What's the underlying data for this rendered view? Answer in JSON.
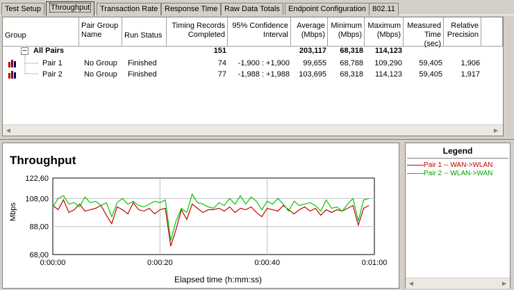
{
  "tabs": [
    "Test Setup",
    "Throughput",
    "Transaction Rate",
    "Response Time",
    "Raw Data Totals",
    "Endpoint Configuration",
    "802.11"
  ],
  "active_tab": 1,
  "table": {
    "headers": {
      "group": "Group",
      "pair_group_name": "Pair Group Name",
      "run_status": "Run Status",
      "timing_records": "Timing Records Completed",
      "confidence": "95% Confidence Interval",
      "average": "Average (Mbps)",
      "minimum": "Minimum (Mbps)",
      "maximum": "Maximum (Mbps)",
      "measured_time": "Measured Time (sec)",
      "relative_precision": "Relative Precision"
    },
    "all_pairs": {
      "expander": "−",
      "label": "All Pairs",
      "timing_records": "151",
      "average": "203,117",
      "minimum": "68,318",
      "maximum": "114,123"
    },
    "rows": [
      {
        "group": "Pair 1",
        "pair_group_name": "No Group",
        "run_status": "Finished",
        "timing_records": "74",
        "confidence": "-1,900 : +1,900",
        "average": "99,655",
        "minimum": "68,788",
        "maximum": "109,290",
        "measured_time": "59,405",
        "relative_precision": "1,906"
      },
      {
        "group": "Pair 2",
        "pair_group_name": "No Group",
        "run_status": "Finished",
        "timing_records": "77",
        "confidence": "-1,988 : +1,988",
        "average": "103,695",
        "minimum": "68,318",
        "maximum": "114,123",
        "measured_time": "59,405",
        "relative_precision": "1,917"
      }
    ]
  },
  "chart": {
    "title": "Throughput",
    "ylabel": "Mbps",
    "xlabel": "Elapsed time (h:mm:ss)",
    "yticks": [
      "122,60",
      "108,00",
      "88,00",
      "68,00"
    ],
    "xticks": [
      "0:00:00",
      "0:00:20",
      "0:00:40",
      "0:01:00"
    ],
    "colors": {
      "pair1": "#c00000",
      "pair2": "#00c800"
    }
  },
  "legend": {
    "title": "Legend",
    "items": [
      "Pair 1 -- WAN->WLAN",
      "Pair 2 -- WLAN->WAN"
    ]
  },
  "chart_data": {
    "type": "line",
    "title": "Throughput",
    "xlabel": "Elapsed time (h:mm:ss)",
    "ylabel": "Mbps",
    "xlim": [
      0,
      60
    ],
    "ylim": [
      68,
      122.6
    ],
    "series": [
      {
        "name": "Pair 1 -- WAN->WLAN",
        "color": "#c00000",
        "x": [
          0,
          1,
          2,
          3,
          4,
          5,
          6,
          7,
          8,
          9,
          10,
          11,
          12,
          13,
          14,
          15,
          16,
          17,
          18,
          19,
          20,
          21,
          22,
          23,
          24,
          25,
          26,
          27,
          28,
          29,
          30,
          31,
          32,
          33,
          34,
          35,
          36,
          37,
          38,
          39,
          40,
          41,
          42,
          43,
          44,
          45,
          46,
          47,
          48,
          49,
          50,
          51,
          52,
          53,
          54,
          55,
          56,
          57,
          58,
          59
        ],
        "values": [
          103,
          100,
          107,
          98,
          100,
          104,
          99,
          100,
          101,
          103,
          96,
          90,
          102,
          100,
          97,
          105,
          100,
          99,
          101,
          97,
          100,
          101,
          74,
          86,
          100,
          93,
          104,
          101,
          98,
          100,
          100,
          101,
          99,
          102,
          98,
          101,
          100,
          102,
          98,
          95,
          101,
          100,
          99,
          103,
          100,
          97,
          100,
          102,
          99,
          101,
          96,
          100,
          98,
          100,
          99,
          101,
          103,
          89,
          101,
          103
        ]
      },
      {
        "name": "Pair 2 -- WLAN->WAN",
        "color": "#00c800",
        "x": [
          0,
          1,
          2,
          3,
          4,
          5,
          6,
          7,
          8,
          9,
          10,
          11,
          12,
          13,
          14,
          15,
          16,
          17,
          18,
          19,
          20,
          21,
          22,
          23,
          24,
          25,
          26,
          27,
          28,
          29,
          30,
          31,
          32,
          33,
          34,
          35,
          36,
          37,
          38,
          39,
          40,
          41,
          42,
          43,
          44,
          45,
          46,
          47,
          48,
          49,
          50,
          51,
          52,
          53,
          54,
          55,
          56,
          57,
          58,
          59
        ],
        "values": [
          102,
          108,
          110,
          104,
          105,
          102,
          109,
          105,
          106,
          103,
          105,
          95,
          105,
          108,
          104,
          106,
          103,
          102,
          104,
          106,
          105,
          107,
          78,
          92,
          101,
          98,
          111,
          105,
          104,
          102,
          101,
          105,
          103,
          108,
          104,
          110,
          104,
          109,
          106,
          100,
          106,
          104,
          108,
          104,
          99,
          106,
          103,
          104,
          105,
          103,
          99,
          107,
          101,
          102,
          99,
          104,
          108,
          92,
          107,
          108
        ]
      }
    ]
  }
}
